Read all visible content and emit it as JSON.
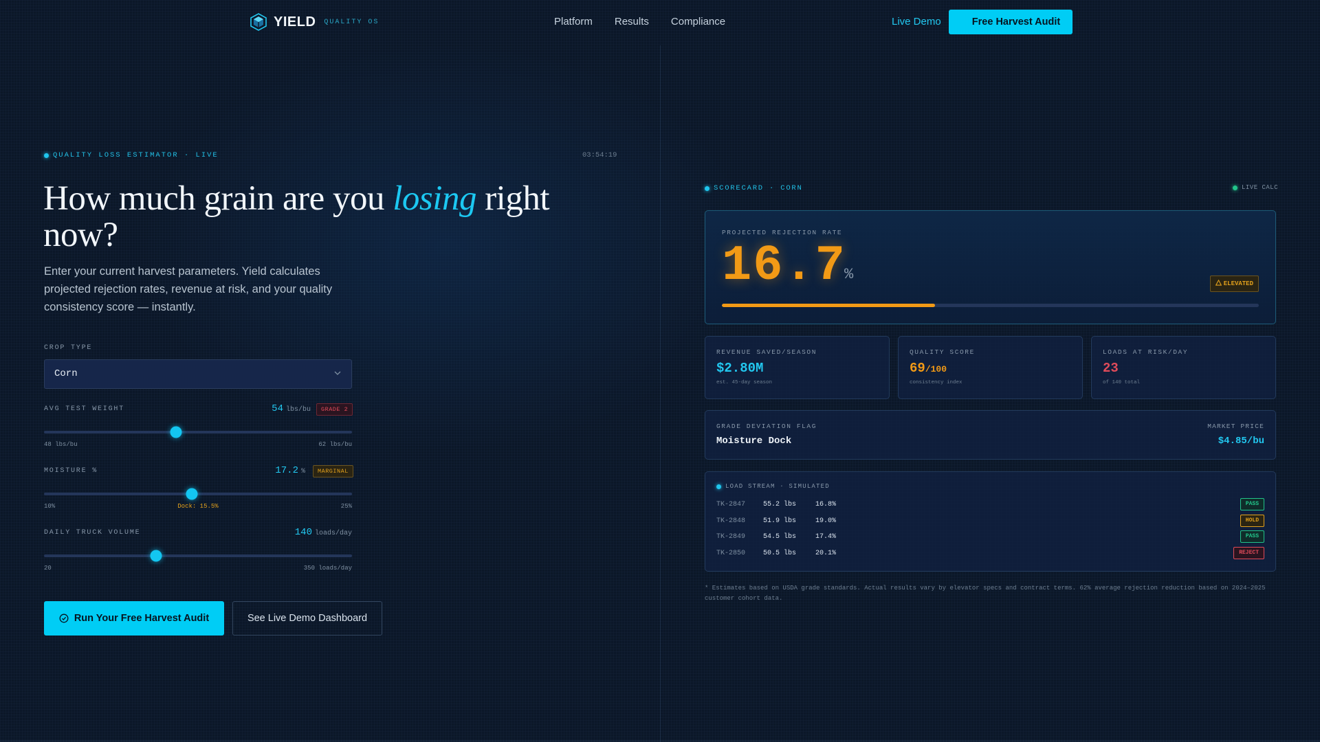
{
  "nav": {
    "brand": "YIELD",
    "brand_sub": "QUALITY OS",
    "links": [
      "Platform",
      "Results",
      "Compliance"
    ],
    "live_demo": "Live Demo",
    "cta": "Free Harvest Audit"
  },
  "hero": {
    "kicker": "QUALITY LOSS ESTIMATOR · LIVE",
    "clock": "03:54:19",
    "headline_pre": "How much grain are you ",
    "headline_accent": "losing",
    "headline_post": " right now?",
    "lead": "Enter your current harvest parameters. Yield calculates projected rejection rates, revenue at risk, and your quality consistency score — instantly."
  },
  "form": {
    "crop_label": "CROP TYPE",
    "crop_value": "Corn",
    "weight": {
      "label": "AVG TEST WEIGHT",
      "value": "54",
      "unit": "lbs/bu",
      "badge": "GRADE 2",
      "min_label": "48 lbs/bu",
      "max_label": "62 lbs/bu",
      "min": 48,
      "max": 62,
      "current": 54
    },
    "moisture": {
      "label": "MOISTURE %",
      "value": "17.2",
      "unit": "%",
      "badge": "MARGINAL",
      "min_label": "10%",
      "mid_label": "Dock: 15.5%",
      "max_label": "25%",
      "min": 10,
      "max": 25,
      "current": 17.2
    },
    "trucks": {
      "label": "DAILY TRUCK VOLUME",
      "value": "140",
      "unit": "loads/day",
      "min_label": "20",
      "max_label": "350 loads/day",
      "min": 20,
      "max": 350,
      "current": 140
    },
    "run_button": "Run Your Free Harvest Audit",
    "demo_button": "See Live Demo Dashboard"
  },
  "scorecard": {
    "kicker": "SCORECARD · CORN",
    "live": "LIVE CALC",
    "rejection_label": "PROJECTED REJECTION RATE",
    "rejection_value": "16.7",
    "rejection_unit": "%",
    "rejection_fraction": 0.397,
    "rejection_badge": "ELEVATED",
    "stats": [
      {
        "label": "REVENUE SAVED/SEASON",
        "value": "$2.80M",
        "sub": "est. 45-day season",
        "color": "#22c8f0"
      },
      {
        "label": "QUALITY SCORE",
        "value": "69",
        "value_suffix": "/100",
        "sub": "consistency index",
        "color": "#f29a16"
      },
      {
        "label": "LOADS AT RISK/DAY",
        "value": "23",
        "sub": "of 140 total",
        "color": "#e04b5a"
      }
    ],
    "flag_label": "GRADE DEVIATION FLAG",
    "flag_value": "Moisture Dock",
    "price_label": "MARKET PRICE",
    "price_value": "$4.85/bu",
    "stream_label": "LOAD STREAM · SIMULATED",
    "stream": [
      {
        "id": "TK-2847",
        "weight": "55.2 lbs",
        "moisture": "16.8%",
        "status": "PASS"
      },
      {
        "id": "TK-2848",
        "weight": "51.9 lbs",
        "moisture": "19.0%",
        "status": "HOLD"
      },
      {
        "id": "TK-2849",
        "weight": "54.5 lbs",
        "moisture": "17.4%",
        "status": "PASS"
      },
      {
        "id": "TK-2850",
        "weight": "50.5 lbs",
        "moisture": "20.1%",
        "status": "REJECT"
      }
    ],
    "footnote": "* Estimates based on USDA grade standards. Actual results vary by elevator specs and contract terms. 62% average rejection reduction based on 2024–2025 customer cohort data."
  },
  "colors": {
    "accent": "#00cdf5",
    "warning": "#f29a16",
    "danger": "#e04b5a",
    "success": "#22c48a"
  },
  "icons": [
    "yield-logo-icon",
    "chevron-down-icon",
    "check-circle-icon",
    "warning-triangle-icon"
  ]
}
